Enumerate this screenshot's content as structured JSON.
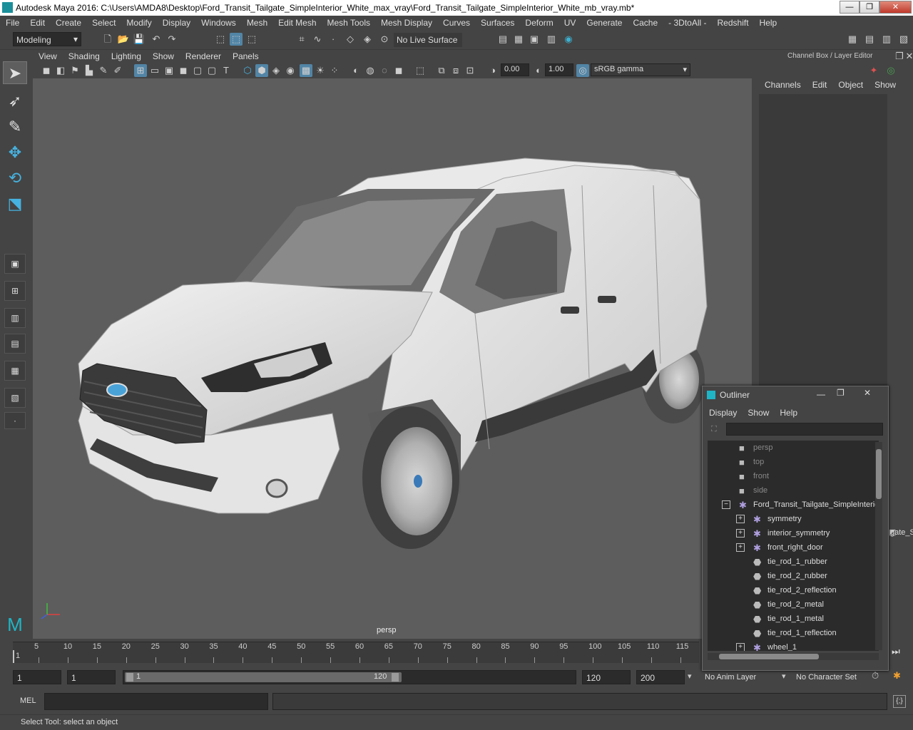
{
  "window": {
    "title": "Autodesk Maya 2016: C:\\Users\\AMDA8\\Desktop\\Ford_Transit_Tailgate_SimpleInterior_White_max_vray\\Ford_Transit_Tailgate_SimpleInterior_White_mb_vray.mb*",
    "minimize": "—",
    "restore": "❐",
    "close": "✕"
  },
  "menubar": [
    "File",
    "Edit",
    "Create",
    "Select",
    "Modify",
    "Display",
    "Windows",
    "Mesh",
    "Edit Mesh",
    "Mesh Tools",
    "Mesh Display",
    "Curves",
    "Surfaces",
    "Deform",
    "UV",
    "Generate",
    "Cache",
    "- 3DtoAll -",
    "Redshift",
    "Help"
  ],
  "shelf": {
    "mode": "Modeling",
    "live_surface": "No Live Surface"
  },
  "viewport": {
    "menu": [
      "View",
      "Shading",
      "Lighting",
      "Show",
      "Renderer",
      "Panels"
    ],
    "exposure": "0.00",
    "gamma": "1.00",
    "color_space": "sRGB gamma",
    "camera_label": "persp"
  },
  "channel_box": {
    "title": "Channel Box / Layer Editor",
    "menu": [
      "Channels",
      "Edit",
      "Object",
      "Show"
    ],
    "clipped_text": "gate_S"
  },
  "outliner": {
    "title": "Outliner",
    "menu": [
      "Display",
      "Show",
      "Help"
    ],
    "rows": [
      {
        "label": "persp",
        "type": "camera"
      },
      {
        "label": "top",
        "type": "camera"
      },
      {
        "label": "front",
        "type": "camera"
      },
      {
        "label": "side",
        "type": "camera"
      },
      {
        "label": "Ford_Transit_Tailgate_SimpleInterior_White",
        "type": "group"
      },
      {
        "label": "symmetry",
        "type": "group"
      },
      {
        "label": "interior_symmetry",
        "type": "group"
      },
      {
        "label": "front_right_door",
        "type": "group"
      },
      {
        "label": "tie_rod_1_rubber",
        "type": "mesh"
      },
      {
        "label": "tie_rod_2_rubber",
        "type": "mesh"
      },
      {
        "label": "tie_rod_2_reflection",
        "type": "mesh"
      },
      {
        "label": "tie_rod_2_metal",
        "type": "mesh"
      },
      {
        "label": "tie_rod_1_metal",
        "type": "mesh"
      },
      {
        "label": "tie_rod_1_reflection",
        "type": "mesh"
      },
      {
        "label": "wheel_1",
        "type": "group"
      }
    ]
  },
  "timeline": {
    "ticks": [
      "5",
      "10",
      "15",
      "20",
      "25",
      "30",
      "35",
      "40",
      "45",
      "50",
      "55",
      "60",
      "65",
      "70",
      "75",
      "80",
      "85",
      "90",
      "95",
      "100",
      "105",
      "110",
      "115"
    ],
    "current_frame": "1"
  },
  "range": {
    "start": "1",
    "playback_start": "1",
    "slider_start": "1",
    "slider_end": "120",
    "playback_end": "120",
    "end": "200",
    "anim_layer": "No Anim Layer",
    "character_set": "No Character Set"
  },
  "command": {
    "label": "MEL"
  },
  "help_line": "Select Tool: select an object"
}
